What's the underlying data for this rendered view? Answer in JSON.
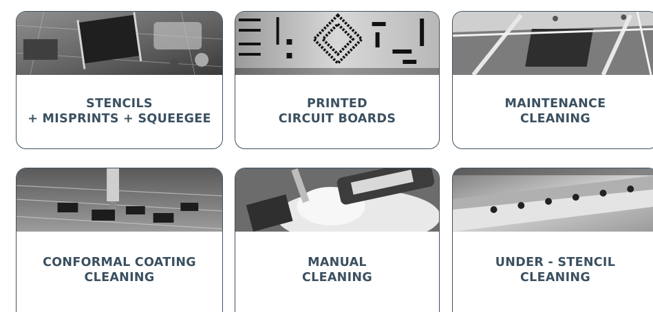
{
  "cards": [
    {
      "line1": "STENCILS",
      "line2": "+ MISPRINTS + SQUEEGEE",
      "image_icon": "circuit-chip-photo"
    },
    {
      "line1": "PRINTED",
      "line2": "CIRCUIT BOARDS",
      "image_icon": "stencil-pattern-photo"
    },
    {
      "line1": "MAINTENANCE",
      "line2": "CLEANING",
      "image_icon": "machine-frame-photo"
    },
    {
      "line1": "CONFORMAL COATING",
      "line2": "CLEANING",
      "image_icon": "coating-nozzle-photo"
    },
    {
      "line1": "MANUAL",
      "line2": "CLEANING",
      "image_icon": "hand-wiping-photo"
    },
    {
      "line1": "UNDER - STENCIL",
      "line2": "CLEANING",
      "image_icon": "stencil-rail-photo"
    }
  ],
  "colors": {
    "text": "#3b5060",
    "border": "#3b5060",
    "background": "#ffffff"
  }
}
